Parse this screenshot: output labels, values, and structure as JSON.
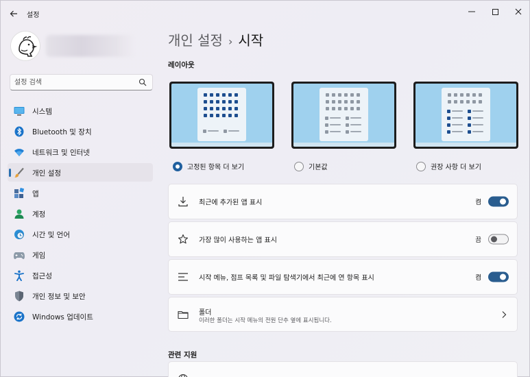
{
  "window": {
    "title": "설정"
  },
  "sidebar": {
    "search_placeholder": "설정 검색",
    "items": [
      {
        "label": "시스템",
        "icon": "monitor-icon"
      },
      {
        "label": "Bluetooth 및 장치",
        "icon": "bluetooth-icon"
      },
      {
        "label": "네트워크 및 인터넷",
        "icon": "wifi-icon"
      },
      {
        "label": "개인 설정",
        "icon": "paintbrush-icon",
        "active": true
      },
      {
        "label": "앱",
        "icon": "apps-icon"
      },
      {
        "label": "계정",
        "icon": "person-icon"
      },
      {
        "label": "시간 및 언어",
        "icon": "clock-globe-icon"
      },
      {
        "label": "게임",
        "icon": "gamepad-icon"
      },
      {
        "label": "접근성",
        "icon": "accessibility-icon"
      },
      {
        "label": "개인 정보 및 보안",
        "icon": "shield-icon"
      },
      {
        "label": "Windows 업데이트",
        "icon": "update-icon"
      }
    ]
  },
  "breadcrumb": {
    "parent": "개인 설정",
    "separator": "›",
    "current": "시작"
  },
  "layout": {
    "title": "레이아웃",
    "options": [
      {
        "label": "고정된 항목 더 보기",
        "selected": true
      },
      {
        "label": "기본값",
        "selected": false
      },
      {
        "label": "권장 사항 더 보기",
        "selected": false
      }
    ]
  },
  "settings": [
    {
      "label": "최근에 추가된 앱 표시",
      "state": "켬",
      "on": true,
      "icon": "download-icon"
    },
    {
      "label": "가장 많이 사용하는 앱 표시",
      "state": "끔",
      "on": false,
      "icon": "star-icon"
    },
    {
      "label": "시작 메뉴, 점프 목록 및 파일 탐색기에서 최근에 연 항목 표시",
      "state": "켬",
      "on": true,
      "icon": "list-icon"
    }
  ],
  "folders": {
    "title": "폴더",
    "description": "이러한 폴더는 시작 메뉴의 전원 단추 옆에 표시됩니다.",
    "icon": "folder-icon"
  },
  "related": {
    "title": "관련 지원"
  },
  "colors": {
    "accent": "#2a5d8f",
    "thumbnail_bg": "#9fd1ee"
  }
}
